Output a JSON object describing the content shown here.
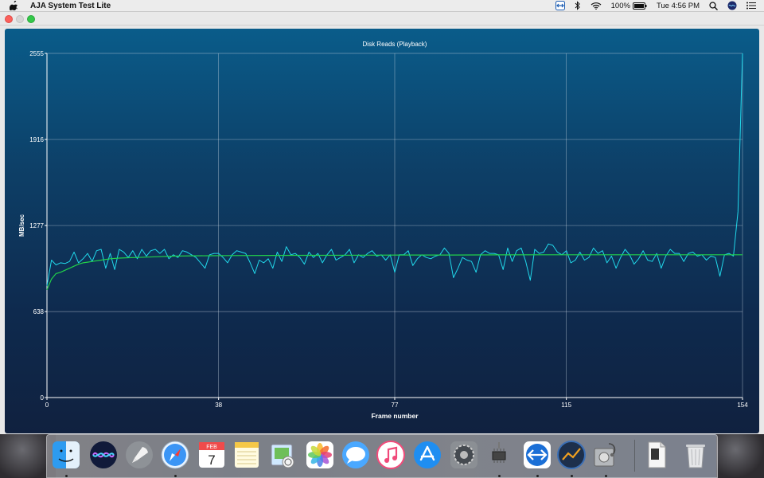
{
  "menubar": {
    "app_name": "AJA System Test Lite",
    "battery": "100%",
    "clock": "Tue 4:56 PM"
  },
  "window": {
    "title": ""
  },
  "chart_data": {
    "type": "line",
    "title": "Disk Reads (Playback)",
    "xlabel": "Frame number",
    "ylabel": "MB/sec",
    "xlim": [
      0,
      154
    ],
    "ylim": [
      0,
      2555
    ],
    "xticks": [
      "0",
      "38",
      "77",
      "115",
      "154"
    ],
    "yticks": [
      "0",
      "638",
      "1277",
      "1916",
      "2555"
    ],
    "grid": true,
    "colors": {
      "instant": "#21d8ea",
      "average": "#22d14a",
      "grid": "#c9d6e0",
      "axis": "#ffffff"
    },
    "series": [
      {
        "color": "#21d8ea",
        "x": [
          0,
          1,
          2,
          3,
          4,
          5,
          6,
          7,
          8,
          9,
          10,
          11,
          12,
          13,
          14,
          15,
          16,
          17,
          18,
          19,
          20,
          21,
          22,
          23,
          24,
          25,
          26,
          27,
          28,
          29,
          30,
          31,
          32,
          33,
          34,
          35,
          36,
          37,
          38,
          39,
          40,
          41,
          42,
          43,
          44,
          45,
          46,
          47,
          48,
          49,
          50,
          51,
          52,
          53,
          54,
          55,
          56,
          57,
          58,
          59,
          60,
          61,
          62,
          63,
          64,
          65,
          66,
          67,
          68,
          69,
          70,
          71,
          72,
          73,
          74,
          75,
          76,
          77,
          78,
          79,
          80,
          81,
          82,
          83,
          84,
          85,
          86,
          87,
          88,
          89,
          90,
          91,
          92,
          93,
          94,
          95,
          96,
          97,
          98,
          99,
          100,
          101,
          102,
          103,
          104,
          105,
          106,
          107,
          108,
          109,
          110,
          111,
          112,
          113,
          114,
          115,
          116,
          117,
          118,
          119,
          120,
          121,
          122,
          123,
          124,
          125,
          126,
          127,
          128,
          129,
          130,
          131,
          132,
          133,
          134,
          135,
          136,
          137,
          138,
          139,
          140,
          141,
          142,
          143,
          144,
          145,
          146,
          147,
          148,
          149,
          150,
          151,
          152,
          153,
          154
        ],
        "values": [
          830,
          1020,
          985,
          1000,
          995,
          1010,
          1080,
          1000,
          1030,
          1070,
          1010,
          1090,
          1100,
          960,
          1070,
          950,
          1100,
          1080,
          1040,
          1090,
          1030,
          1100,
          1050,
          1090,
          1100,
          1070,
          1100,
          1030,
          1060,
          1040,
          1090,
          1080,
          1060,
          1040,
          1000,
          960,
          1060,
          1070,
          1070,
          1040,
          1000,
          1060,
          1090,
          1080,
          1070,
          1000,
          920,
          1020,
          1000,
          1030,
          960,
          1080,
          1010,
          1120,
          1060,
          1070,
          1040,
          990,
          1080,
          1040,
          1070,
          1000,
          1060,
          1100,
          1020,
          1040,
          1060,
          1100,
          1000,
          1060,
          1040,
          1070,
          1090,
          1050,
          1060,
          1020,
          1060,
          930,
          1060,
          1060,
          1090,
          980,
          1030,
          1060,
          1040,
          1030,
          1050,
          1060,
          1110,
          1070,
          890,
          960,
          1040,
          1020,
          1010,
          930,
          1060,
          1090,
          1070,
          1070,
          1060,
          950,
          1110,
          1010,
          1090,
          1110,
          1010,
          870,
          1100,
          1070,
          1080,
          1140,
          1130,
          1080,
          1060,
          1090,
          1000,
          1020,
          1080,
          1020,
          1040,
          1110,
          1070,
          1090,
          1000,
          1050,
          960,
          1040,
          1100,
          1060,
          990,
          1030,
          1090,
          1020,
          1010,
          1070,
          960,
          1050,
          1100,
          1070,
          1070,
          1010,
          1070,
          1080,
          1050,
          1060,
          1020,
          1050,
          1040,
          900,
          1060,
          1070,
          1050,
          1380,
          2555
        ]
      },
      {
        "color": "#22d14a",
        "x": [
          0,
          1,
          2,
          3,
          4,
          5,
          6,
          7,
          8,
          9,
          10,
          12,
          14,
          16,
          18,
          20,
          24,
          28,
          32,
          36,
          40,
          50,
          60,
          70,
          80,
          90,
          100,
          110,
          120,
          130,
          140,
          150,
          154
        ],
        "values": [
          800,
          880,
          920,
          930,
          945,
          960,
          975,
          990,
          1000,
          1005,
          1010,
          1020,
          1030,
          1035,
          1038,
          1040,
          1045,
          1050,
          1052,
          1053,
          1054,
          1055,
          1056,
          1057,
          1058,
          1058,
          1059,
          1060,
          1060,
          1060,
          1060,
          1060,
          1060
        ]
      }
    ]
  },
  "dock": {
    "apps": [
      {
        "name": "Finder",
        "icon": "finder-icon",
        "running": true
      },
      {
        "name": "Siri",
        "icon": "siri-icon",
        "running": false
      },
      {
        "name": "Launchpad",
        "icon": "launchpad-icon",
        "running": false
      },
      {
        "name": "Safari",
        "icon": "safari-icon",
        "running": true
      },
      {
        "name": "Calendar",
        "icon": "calendar-icon",
        "running": false,
        "month": "FEB",
        "day": "7"
      },
      {
        "name": "Notes",
        "icon": "notes-icon",
        "running": false
      },
      {
        "name": "Preview",
        "icon": "preview-icon",
        "running": false
      },
      {
        "name": "Photos",
        "icon": "photos-icon",
        "running": false
      },
      {
        "name": "Messages",
        "icon": "messages-icon",
        "running": false
      },
      {
        "name": "iTunes",
        "icon": "itunes-icon",
        "running": false
      },
      {
        "name": "App Store",
        "icon": "app-store-icon",
        "running": false
      },
      {
        "name": "System Preferences",
        "icon": "system-preferences-icon",
        "running": false
      },
      {
        "name": "System Information",
        "icon": "system-information-icon",
        "running": true
      },
      {
        "name": "TeamViewer",
        "icon": "teamviewer-icon",
        "running": true
      },
      {
        "name": "AJA System Test Lite",
        "icon": "aja-system-test-icon",
        "running": true
      },
      {
        "name": "Disk Utility",
        "icon": "disk-utility-icon",
        "running": true
      },
      {
        "name": "Document",
        "icon": "document-icon",
        "running": false,
        "badge": "BIN"
      },
      {
        "name": "Trash",
        "icon": "trash-icon",
        "running": false
      }
    ]
  }
}
